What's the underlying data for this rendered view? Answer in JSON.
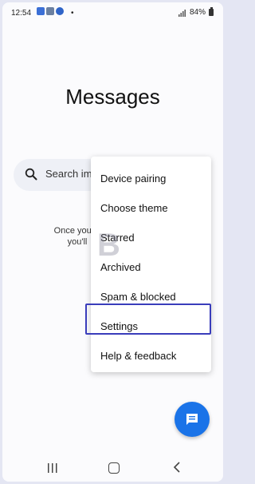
{
  "status_bar": {
    "time": "12:54",
    "dot": "•",
    "battery": "84%",
    "icons": [
      "notification-icon",
      "notification-icon",
      "calendar-icon",
      "signal-icon",
      "battery-icon"
    ]
  },
  "header": {
    "title": "Messages"
  },
  "search": {
    "placeholder": "Search ima"
  },
  "empty_state": {
    "line1": "Once you st",
    "line2": "you'll"
  },
  "menu": {
    "items": [
      {
        "label": "Device pairing"
      },
      {
        "label": "Choose theme"
      },
      {
        "label": "Starred"
      },
      {
        "label": "Archived"
      },
      {
        "label": "Spam & blocked"
      },
      {
        "label": "Settings",
        "highlighted": true
      },
      {
        "label": "Help & feedback"
      }
    ]
  },
  "watermark": {
    "text": "B"
  },
  "fab": {
    "icon": "compose-message-icon"
  },
  "nav_bar": {
    "icons": [
      "recent-apps-icon",
      "home-icon",
      "back-icon"
    ]
  },
  "colors": {
    "accent": "#1a73e8",
    "highlight": "#3a3dbb",
    "frame": "#e4e6f3"
  }
}
